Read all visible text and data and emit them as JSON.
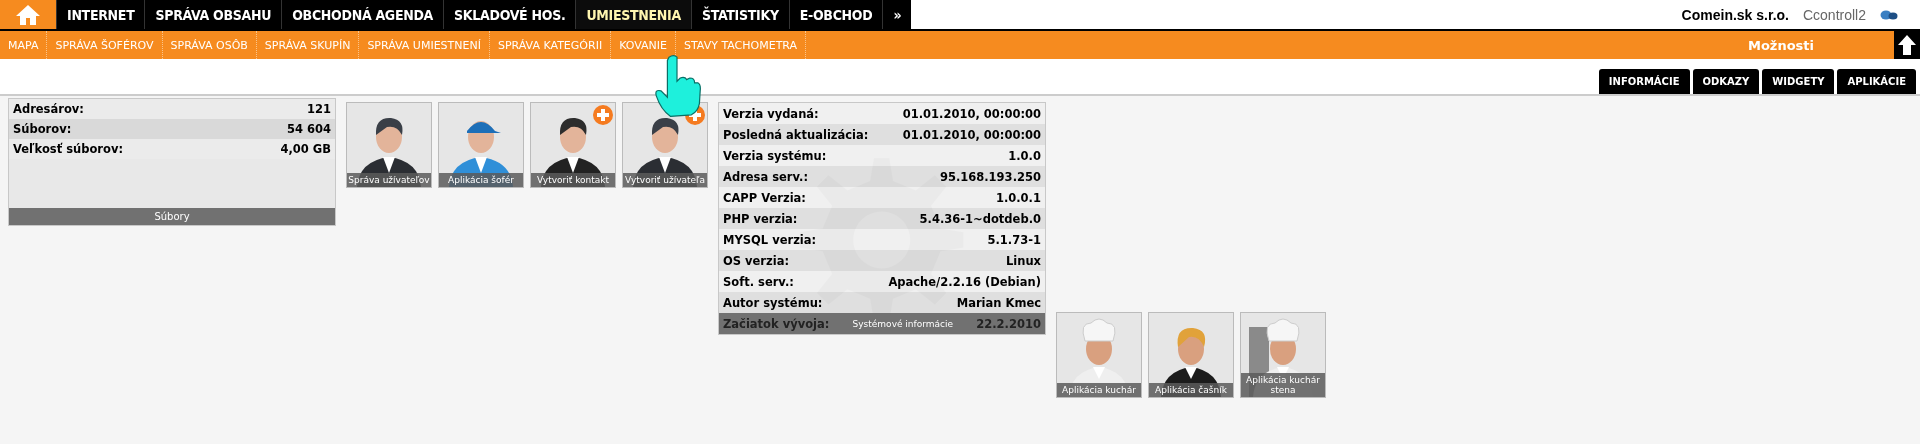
{
  "nav": [
    {
      "label": "INTERNET",
      "selected": false
    },
    {
      "label": "SPRÁVA OBSAHU",
      "selected": false
    },
    {
      "label": "OBCHODNÁ AGENDA",
      "selected": false
    },
    {
      "label": "SKLADOVÉ HOS.",
      "selected": false
    },
    {
      "label": "UMIESTNENIA",
      "selected": true
    },
    {
      "label": "ŠTATISTIKY",
      "selected": false
    },
    {
      "label": "E-OBCHOD",
      "selected": false
    },
    {
      "label": "»",
      "selected": false
    }
  ],
  "company": "Comein.sk s.r.o.",
  "user": "Ccontroll2",
  "submenu": [
    "MAPA",
    "SPRÁVA ŠOFÉROV",
    "SPRÁVA OSÔB",
    "SPRÁVA SKUPÍN",
    "SPRÁVA UMIESTNENÍ",
    "SPRÁVA KATEGÓRII",
    "KOVANIE",
    "STAVY TACHOMETRA"
  ],
  "options_label": "Možnosti",
  "tabs": [
    "INFORMÁCIE",
    "ODKAZY",
    "WIDGETY",
    "APLIKÁCIE"
  ],
  "files_panel": {
    "rows": [
      {
        "label": "Adresárov:",
        "value": "121"
      },
      {
        "label": "Súborov:",
        "value": "54 604"
      },
      {
        "label": "Veľkosť súborov:",
        "value": "4,00 GB"
      }
    ],
    "footer": "Súbory"
  },
  "tiles": [
    {
      "label": "Správa užívateľov",
      "add_badge": false
    },
    {
      "label": "Aplikácia šofér",
      "add_badge": false
    },
    {
      "label": "Vytvoriť kontakt",
      "add_badge": true
    },
    {
      "label": "Vytvoriť užívateľa",
      "add_badge": true
    }
  ],
  "system_info": {
    "rows": [
      {
        "label": "Verzia vydaná:",
        "value": "01.01.2010, 00:00:00"
      },
      {
        "label": "Posledná aktualizácia:",
        "value": "01.01.2010, 00:00:00"
      },
      {
        "label": "Verzia systému:",
        "value": "1.0.0"
      },
      {
        "label": "Adresa serv.:",
        "value": "95.168.193.250"
      },
      {
        "label": "CAPP Verzia:",
        "value": "1.0.0.1"
      },
      {
        "label": "PHP verzia:",
        "value": "5.4.36-1~dotdeb.0"
      },
      {
        "label": "MYSQL verzia:",
        "value": "5.1.73-1"
      },
      {
        "label": "OS verzia:",
        "value": "Linux"
      },
      {
        "label": "Soft. serv.:",
        "value": "Apache/2.2.16 (Debian)"
      },
      {
        "label": "Autor systému:",
        "value": "Marian Kmec"
      }
    ],
    "footer_row": {
      "label": "Začiatok vývoja:",
      "value": "22.2.2010"
    },
    "footer": "Systémové informácie"
  },
  "app_tiles": [
    {
      "label": "Aplikácia kuchár"
    },
    {
      "label": "Aplikácia čašník"
    },
    {
      "label": "Aplikácia kuchár stena"
    }
  ]
}
